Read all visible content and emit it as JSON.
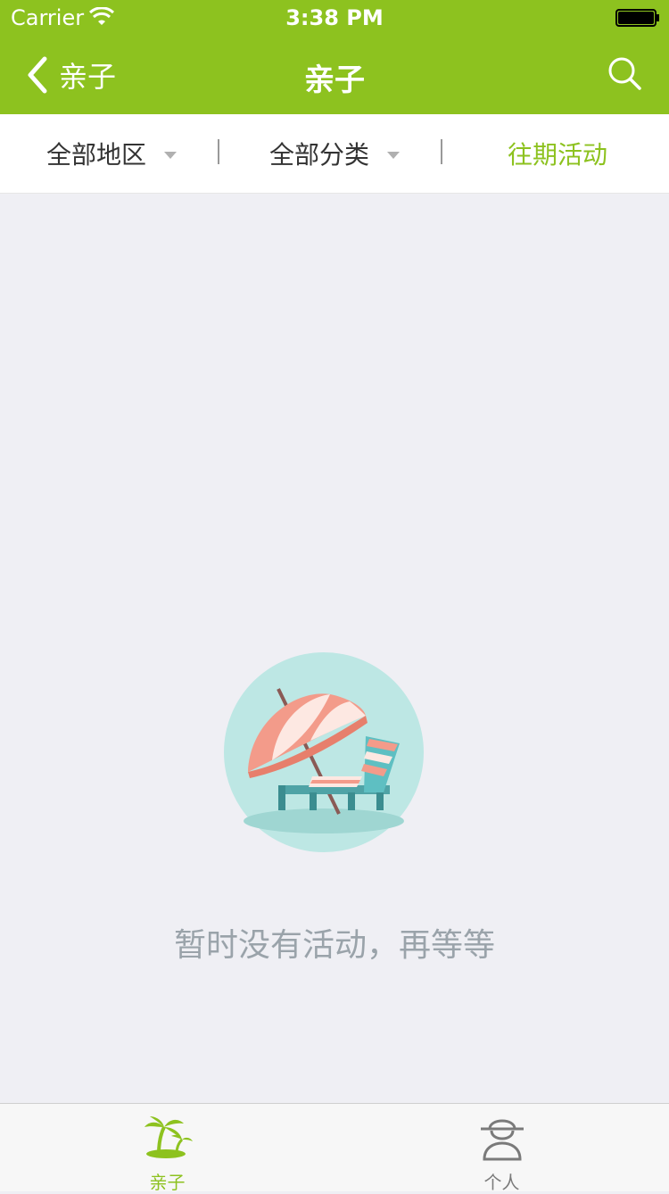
{
  "status_bar": {
    "carrier": "Carrier",
    "time": "3:38 PM"
  },
  "nav": {
    "back_label": "亲子",
    "title": "亲子"
  },
  "filters": {
    "region": "全部地区",
    "category": "全部分类",
    "past_events": "往期活动"
  },
  "empty_state": {
    "message": "暂时没有活动，再等等"
  },
  "tabs": [
    {
      "label": "亲子",
      "icon": "palm-tree-icon",
      "active": true
    },
    {
      "label": "个人",
      "icon": "person-hat-icon",
      "active": false
    }
  ],
  "colors": {
    "brand_green": "#8dc21f",
    "background": "#efeff4",
    "empty_text": "#9aa3aa"
  }
}
